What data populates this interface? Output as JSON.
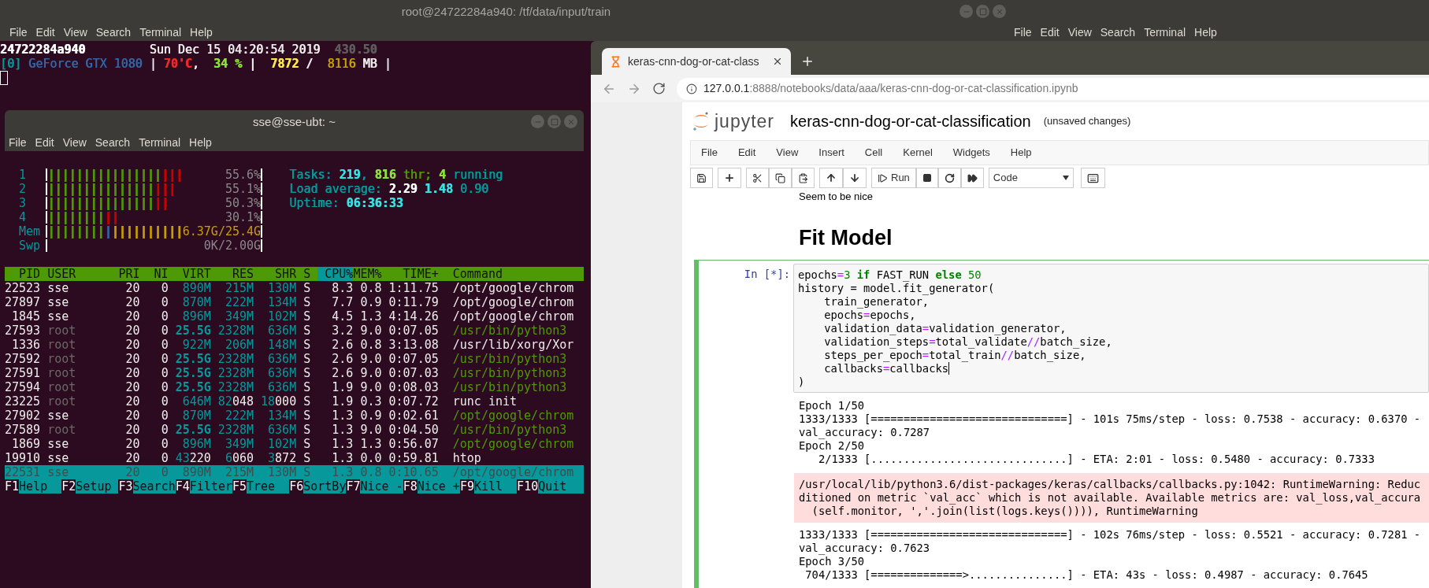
{
  "terminal": {
    "title": "root@24722284a940: /tf/data/input/train",
    "menu": [
      "File",
      "Edit",
      "View",
      "Search",
      "Terminal",
      "Help"
    ],
    "lines": [
      [
        {
          "text": "24722284a940",
          "color": "#ffffff",
          "bold": true
        },
        {
          "text": "         Sun Dec 15 04:20:54 2019",
          "color": "#eeeeec",
          "bold": false
        },
        {
          "text": "  430.50",
          "color": "#5c5c5c",
          "bold": true
        }
      ],
      [
        {
          "text": "[0]",
          "color": "#06989a",
          "bold": false
        },
        {
          "text": " GeForce GTX 1080",
          "color": "#3465a4",
          "bold": false
        },
        {
          "text": " | ",
          "color": "#eeeeec",
          "bold": false
        },
        {
          "text": "70'C",
          "color": "#ef2929",
          "bold": true
        },
        {
          "text": ",  ",
          "color": "#eeeeec",
          "bold": false
        },
        {
          "text": "34 %",
          "color": "#8ae234",
          "bold": true
        },
        {
          "text": " |  ",
          "color": "#eeeeec",
          "bold": false
        },
        {
          "text": "7872",
          "color": "#fce94f",
          "bold": true
        },
        {
          "text": " /  ",
          "color": "#eeeeec",
          "bold": false
        },
        {
          "text": "8116",
          "color": "#c4a000",
          "bold": false
        },
        {
          "text": " MB |",
          "color": "#eeeeec",
          "bold": false
        }
      ]
    ],
    "cursor": true
  },
  "right_terminal": {
    "menu": [
      "File",
      "Edit",
      "View",
      "Search",
      "Terminal",
      "Help"
    ]
  },
  "htop": {
    "title": "sse@sse-ubt: ~",
    "menu": [
      "File",
      "Edit",
      "View",
      "Search",
      "Terminal",
      "Help"
    ],
    "meters": [
      {
        "kind": "cpu",
        "label": "1",
        "bars": [
          {
            "text": "||||||||||||||||",
            "color": "#4e9a06"
          },
          {
            "text": "|||",
            "color": "#cc0000"
          }
        ],
        "reading": "55.6%"
      },
      {
        "kind": "cpu",
        "label": "2",
        "bars": [
          {
            "text": "|||||||||||||||",
            "color": "#4e9a06"
          },
          {
            "text": "|||",
            "color": "#cc0000"
          }
        ],
        "reading": "55.1%"
      },
      {
        "kind": "cpu",
        "label": "3",
        "bars": [
          {
            "text": "|||||||||||||||",
            "color": "#4e9a06"
          },
          {
            "text": "||",
            "color": "#cc0000"
          }
        ],
        "reading": "50.3%"
      },
      {
        "kind": "cpu",
        "label": "4",
        "bars": [
          {
            "text": "||||||||",
            "color": "#4e9a06"
          },
          {
            "text": "||",
            "color": "#cc0000"
          }
        ],
        "reading": "30.1%"
      },
      {
        "kind": "memory",
        "label": "Mem",
        "bars": [
          {
            "text": "||||||||",
            "color": "#4e9a06"
          },
          {
            "text": "|",
            "color": "#3465a4"
          },
          {
            "text": "||||||||||",
            "color": "#c4a000"
          }
        ],
        "reading": "6.37G/25.4G"
      },
      {
        "kind": "swap",
        "label": "Swp",
        "reading": "0K/2.00G"
      }
    ],
    "summary": [
      [
        {
          "text": "Tasks: ",
          "color": "#06989a",
          "bold": false
        },
        {
          "text": "219",
          "color": "#34e2e2",
          "bold": true
        },
        {
          "text": ", ",
          "color": "#06989a",
          "bold": false
        },
        {
          "text": "816",
          "color": "#8ae234",
          "bold": true
        },
        {
          "text": " thr; ",
          "color": "#4e9a06",
          "bold": false
        },
        {
          "text": "4",
          "color": "#8ae234",
          "bold": true
        },
        {
          "text": " running",
          "color": "#06989a",
          "bold": false
        }
      ],
      [
        {
          "text": "Load average: ",
          "color": "#06989a",
          "bold": false
        },
        {
          "text": "2.29 ",
          "color": "#ffffff",
          "bold": true
        },
        {
          "text": "1.48 ",
          "color": "#34e2e2",
          "bold": true
        },
        {
          "text": "0.90",
          "color": "#06989a",
          "bold": false
        }
      ],
      [
        {
          "text": "Uptime: ",
          "color": "#06989a",
          "bold": false
        },
        {
          "text": "06:36:33",
          "color": "#34e2e2",
          "bold": true
        }
      ]
    ],
    "columns": [
      {
        "label": "PID",
        "selected": false
      },
      {
        "label": "USER",
        "selected": false
      },
      {
        "label": "PRI",
        "selected": false
      },
      {
        "label": "NI",
        "selected": false
      },
      {
        "label": "VIRT",
        "selected": false
      },
      {
        "label": "RES",
        "selected": false
      },
      {
        "label": "SHR",
        "selected": false
      },
      {
        "label": "S",
        "selected": false
      },
      {
        "label": "CPU%",
        "selected": true
      },
      {
        "label": "MEM%",
        "selected": false
      },
      {
        "label": "TIME+",
        "selected": false
      },
      {
        "label": "Command",
        "selected": false
      }
    ],
    "processes": [
      {
        "pid": "22523",
        "user": "sse",
        "pri": "20",
        "ni": "0",
        "virt": "890M",
        "res": "215M",
        "shr": "130M",
        "state": "S",
        "cpu": "8.3",
        "mem": "0.8",
        "time": "1:11.75",
        "command": "/opt/google/chrom",
        "user_dimmed": false,
        "virt_large": false,
        "thread": false,
        "selected": false
      },
      {
        "pid": "27897",
        "user": "sse",
        "pri": "20",
        "ni": "0",
        "virt": "870M",
        "res": "222M",
        "shr": "134M",
        "state": "S",
        "cpu": "7.7",
        "mem": "0.9",
        "time": "0:11.79",
        "command": "/opt/google/chrom",
        "user_dimmed": false,
        "virt_large": false,
        "thread": false,
        "selected": false
      },
      {
        "pid": "1845",
        "user": "sse",
        "pri": "20",
        "ni": "0",
        "virt": "896M",
        "res": "349M",
        "shr": "102M",
        "state": "S",
        "cpu": "4.5",
        "mem": "1.3",
        "time": "4:14.26",
        "command": "/opt/google/chrom",
        "user_dimmed": false,
        "virt_large": false,
        "thread": false,
        "selected": false
      },
      {
        "pid": "27593",
        "user": "root",
        "pri": "20",
        "ni": "0",
        "virt": "25.5G",
        "res": "2328M",
        "shr": "636M",
        "state": "S",
        "cpu": "3.2",
        "mem": "9.0",
        "time": "0:07.05",
        "command": "/usr/bin/python3",
        "user_dimmed": true,
        "virt_large": true,
        "thread": true,
        "selected": false
      },
      {
        "pid": "1336",
        "user": "root",
        "pri": "20",
        "ni": "0",
        "virt": "922M",
        "res": "206M",
        "shr": "148M",
        "state": "S",
        "cpu": "2.6",
        "mem": "0.8",
        "time": "3:13.08",
        "command": "/usr/lib/xorg/Xor",
        "user_dimmed": true,
        "virt_large": false,
        "thread": false,
        "selected": false
      },
      {
        "pid": "27592",
        "user": "root",
        "pri": "20",
        "ni": "0",
        "virt": "25.5G",
        "res": "2328M",
        "shr": "636M",
        "state": "S",
        "cpu": "2.6",
        "mem": "9.0",
        "time": "0:07.05",
        "command": "/usr/bin/python3",
        "user_dimmed": true,
        "virt_large": true,
        "thread": true,
        "selected": false
      },
      {
        "pid": "27591",
        "user": "root",
        "pri": "20",
        "ni": "0",
        "virt": "25.5G",
        "res": "2328M",
        "shr": "636M",
        "state": "S",
        "cpu": "2.6",
        "mem": "9.0",
        "time": "0:07.03",
        "command": "/usr/bin/python3",
        "user_dimmed": true,
        "virt_large": true,
        "thread": true,
        "selected": false
      },
      {
        "pid": "27594",
        "user": "root",
        "pri": "20",
        "ni": "0",
        "virt": "25.5G",
        "res": "2328M",
        "shr": "636M",
        "state": "S",
        "cpu": "1.9",
        "mem": "9.0",
        "time": "0:08.03",
        "command": "/usr/bin/python3",
        "user_dimmed": true,
        "virt_large": true,
        "thread": true,
        "selected": false
      },
      {
        "pid": "23225",
        "user": "root",
        "pri": "20",
        "ni": "0",
        "virt": "646M",
        "res": "82048",
        "shr": "18000",
        "state": "S",
        "cpu": "1.9",
        "mem": "0.3",
        "time": "0:07.72",
        "command": "runc init",
        "user_dimmed": true,
        "virt_large": false,
        "thread": false,
        "selected": false
      },
      {
        "pid": "27902",
        "user": "sse",
        "pri": "20",
        "ni": "0",
        "virt": "870M",
        "res": "222M",
        "shr": "134M",
        "state": "S",
        "cpu": "1.3",
        "mem": "0.9",
        "time": "0:02.61",
        "command": "/opt/google/chrom",
        "user_dimmed": false,
        "virt_large": false,
        "thread": true,
        "selected": false
      },
      {
        "pid": "27589",
        "user": "root",
        "pri": "20",
        "ni": "0",
        "virt": "25.5G",
        "res": "2328M",
        "shr": "636M",
        "state": "S",
        "cpu": "1.3",
        "mem": "9.0",
        "time": "0:04.50",
        "command": "/usr/bin/python3",
        "user_dimmed": true,
        "virt_large": true,
        "thread": true,
        "selected": false
      },
      {
        "pid": "1869",
        "user": "sse",
        "pri": "20",
        "ni": "0",
        "virt": "896M",
        "res": "349M",
        "shr": "102M",
        "state": "S",
        "cpu": "1.3",
        "mem": "1.3",
        "time": "0:56.07",
        "command": "/opt/google/chrom",
        "user_dimmed": false,
        "virt_large": false,
        "thread": true,
        "selected": false
      },
      {
        "pid": "19910",
        "user": "sse",
        "pri": "20",
        "ni": "0",
        "virt": "43220",
        "res": "6060",
        "shr": "3872",
        "state": "S",
        "cpu": "1.3",
        "mem": "0.0",
        "time": "0:59.81",
        "command": "htop",
        "user_dimmed": false,
        "virt_large": false,
        "thread": false,
        "selected": false
      },
      {
        "pid": "22531",
        "user": "sse",
        "pri": "20",
        "ni": "0",
        "virt": "890M",
        "res": "215M",
        "shr": "130M",
        "state": "S",
        "cpu": "1.3",
        "mem": "0.8",
        "time": "0:10.65",
        "command": "/opt/google/chrom",
        "user_dimmed": false,
        "virt_large": false,
        "thread": false,
        "selected": true
      }
    ],
    "function_keys": [
      {
        "key": "F1",
        "label": "Help"
      },
      {
        "key": "F2",
        "label": "Setup"
      },
      {
        "key": "F3",
        "label": "Search"
      },
      {
        "key": "F4",
        "label": "Filter"
      },
      {
        "key": "F5",
        "label": "Tree"
      },
      {
        "key": "F6",
        "label": "SortBy"
      },
      {
        "key": "F7",
        "label": "Nice -"
      },
      {
        "key": "F8",
        "label": "Nice +"
      },
      {
        "key": "F9",
        "label": "Kill"
      },
      {
        "key": "F10",
        "label": "Quit"
      }
    ]
  },
  "browser": {
    "tab": {
      "title": "keras-cnn-dog-or-cat-class"
    },
    "url": {
      "host": "127.0.0.1",
      "path": ":8888/notebooks/data/aaa/keras-cnn-dog-or-cat-classification.ipynb"
    },
    "notebook": {
      "logo_text": "jupyter",
      "title": "keras-cnn-dog-or-cat-classification",
      "save_status": "(unsaved changes)",
      "menu": [
        "File",
        "Edit",
        "View",
        "Insert",
        "Cell",
        "Kernel",
        "Widgets",
        "Help"
      ],
      "toolbar": {
        "run_label": "Run",
        "cell_type": "Code"
      },
      "markdown_tail": "Seem to be nice",
      "heading": "Fit Model",
      "cell": {
        "prompt": "In [*]:",
        "selected": true,
        "lines": [
          {
            "indented": false,
            "cursor": false,
            "tokens": [
              {
                "text": "epochs",
                "kind": "name"
              },
              {
                "text": "=",
                "kind": "op"
              },
              {
                "text": "3",
                "kind": "num"
              },
              {
                "text": " if",
                "kind": "kw"
              },
              {
                "text": " FAST_RUN ",
                "kind": "name"
              },
              {
                "text": "else",
                "kind": "kw"
              },
              {
                "text": " 50",
                "kind": "num"
              }
            ]
          },
          {
            "indented": false,
            "cursor": false,
            "tokens": [
              {
                "text": "history = model.fit_generator(",
                "kind": "name"
              }
            ]
          },
          {
            "indented": true,
            "cursor": false,
            "tokens": [
              {
                "text": "train_generator,",
                "kind": "name"
              }
            ]
          },
          {
            "indented": true,
            "cursor": false,
            "tokens": [
              {
                "text": "epochs",
                "kind": "name"
              },
              {
                "text": "=",
                "kind": "op"
              },
              {
                "text": "epochs,",
                "kind": "name"
              }
            ]
          },
          {
            "indented": true,
            "cursor": false,
            "tokens": [
              {
                "text": "validation_data",
                "kind": "name"
              },
              {
                "text": "=",
                "kind": "op"
              },
              {
                "text": "validation_generator,",
                "kind": "name"
              }
            ]
          },
          {
            "indented": true,
            "cursor": false,
            "tokens": [
              {
                "text": "validation_steps",
                "kind": "name"
              },
              {
                "text": "=",
                "kind": "op"
              },
              {
                "text": "total_validate",
                "kind": "name"
              },
              {
                "text": "//",
                "kind": "op"
              },
              {
                "text": "batch_size,",
                "kind": "name"
              }
            ]
          },
          {
            "indented": true,
            "cursor": false,
            "tokens": [
              {
                "text": "steps_per_epoch",
                "kind": "name"
              },
              {
                "text": "=",
                "kind": "op"
              },
              {
                "text": "total_train",
                "kind": "name"
              },
              {
                "text": "//",
                "kind": "op"
              },
              {
                "text": "batch_size,",
                "kind": "name"
              }
            ]
          },
          {
            "indented": true,
            "cursor": true,
            "tokens": [
              {
                "text": "callbacks",
                "kind": "name"
              },
              {
                "text": "=",
                "kind": "op"
              },
              {
                "text": "callbacks",
                "kind": "name"
              }
            ]
          },
          {
            "indented": false,
            "cursor": false,
            "tokens": [
              {
                "text": ")",
                "kind": "name"
              }
            ]
          }
        ],
        "outputs": [
          {
            "kind": "stdout",
            "lines": [
              "Epoch 1/50",
              "1333/1333 [==============================] - 101s 75ms/step - loss: 0.7538 - accuracy: 0.6370 -",
              "val_accuracy: 0.7287",
              "Epoch 2/50",
              "   2/1333 [..............................] - ETA: 2:01 - loss: 0.5480 - accuracy: 0.7333"
            ]
          },
          {
            "kind": "stderr",
            "lines": [
              "/usr/local/lib/python3.6/dist-packages/keras/callbacks/callbacks.py:1042: RuntimeWarning: Reduc",
              "ditioned on metric `val_acc` which is not available. Available metrics are: val_loss,val_accura",
              "  (self.monitor, ','.join(list(logs.keys()))), RuntimeWarning"
            ]
          },
          {
            "kind": "stdout",
            "lines": [
              "1333/1333 [==============================] - 102s 76ms/step - loss: 0.5521 - accuracy: 0.7281 -",
              "val_accuracy: 0.7623",
              "Epoch 3/50",
              " 704/1333 [==============>...............] - ETA: 43s - loss: 0.4987 - accuracy: 0.7645"
            ]
          }
        ]
      }
    }
  }
}
